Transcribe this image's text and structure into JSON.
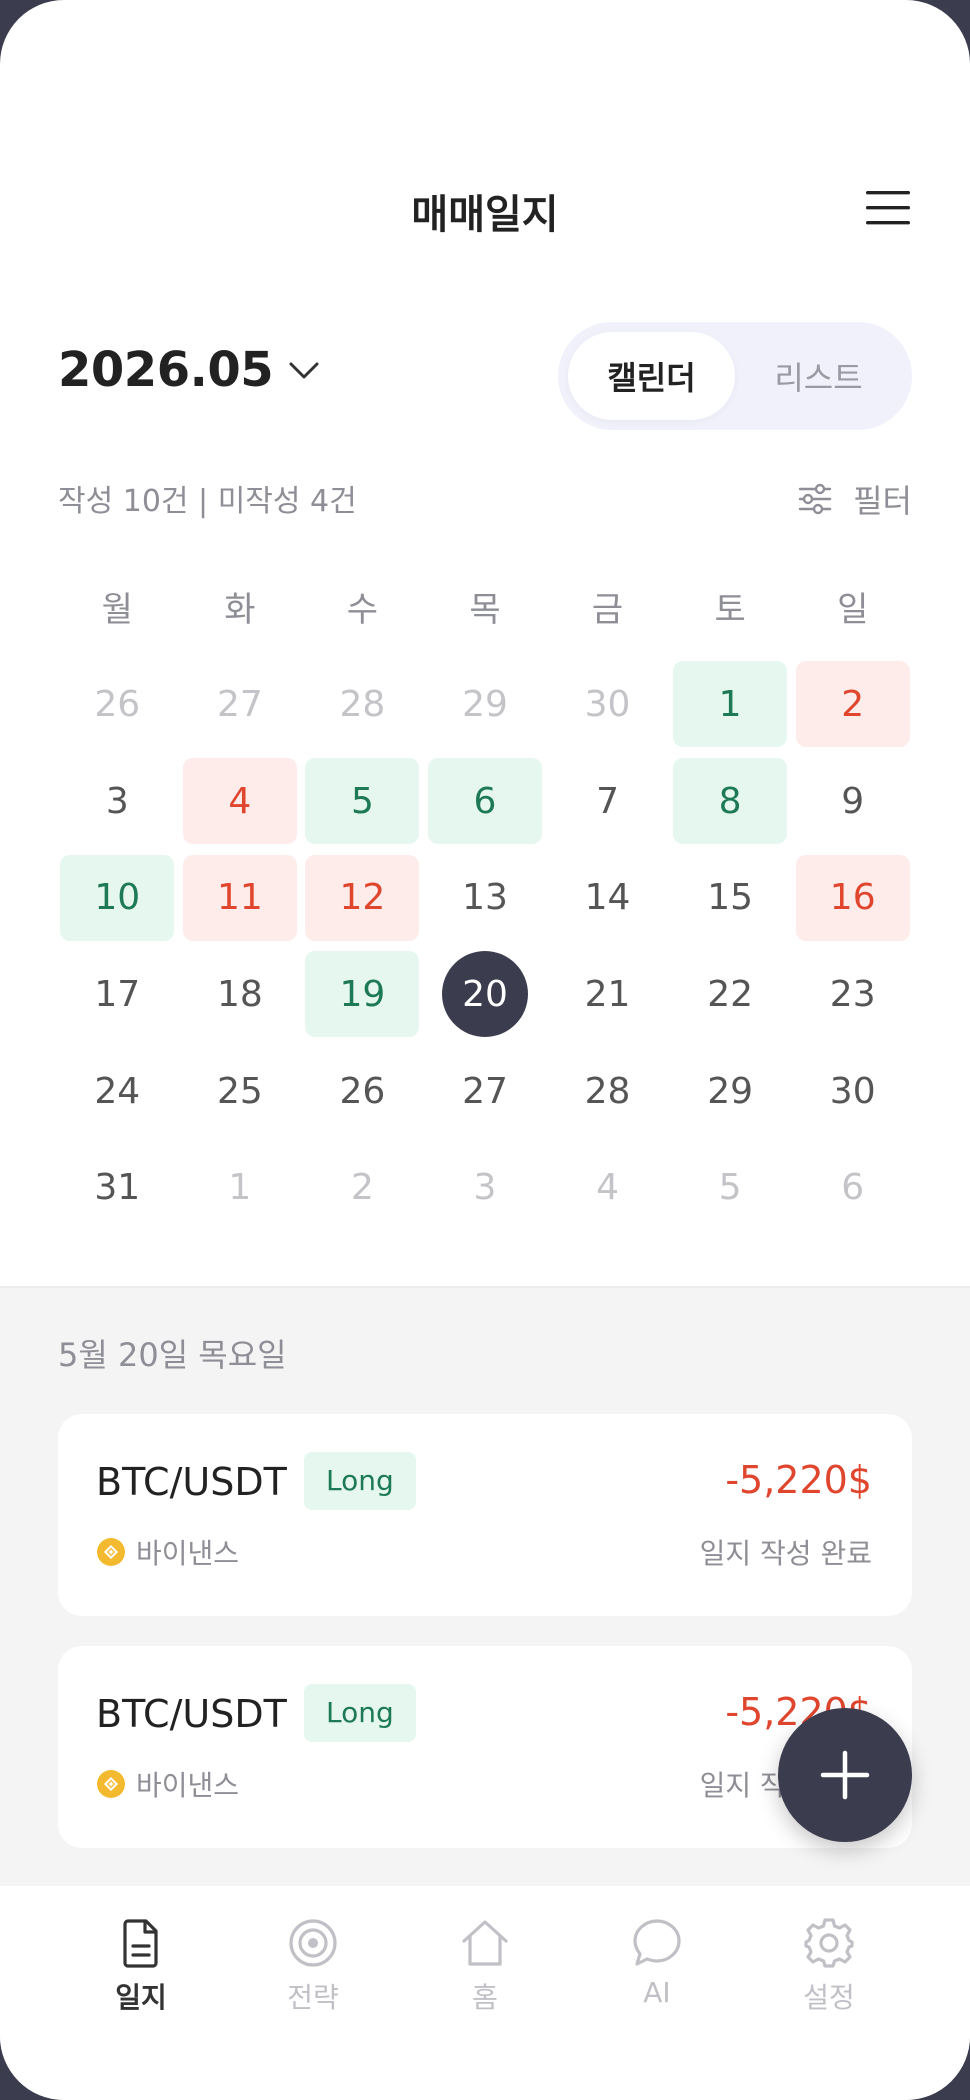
{
  "header": {
    "title": "매매일지"
  },
  "month": {
    "label": "2026.05"
  },
  "view_toggle": {
    "calendar": "캘린더",
    "list": "리스트"
  },
  "summary": {
    "text": "작성 10건 | 미작성 4건",
    "filter_label": "필터"
  },
  "calendar": {
    "weekdays": [
      "월",
      "화",
      "수",
      "목",
      "금",
      "토",
      "일"
    ],
    "days": [
      {
        "n": "26",
        "s": "other"
      },
      {
        "n": "27",
        "s": "other"
      },
      {
        "n": "28",
        "s": "other"
      },
      {
        "n": "29",
        "s": "other"
      },
      {
        "n": "30",
        "s": "other"
      },
      {
        "n": "1",
        "s": "profit"
      },
      {
        "n": "2",
        "s": "loss"
      },
      {
        "n": "3",
        "s": "plain"
      },
      {
        "n": "4",
        "s": "loss"
      },
      {
        "n": "5",
        "s": "profit"
      },
      {
        "n": "6",
        "s": "profit"
      },
      {
        "n": "7",
        "s": "plain"
      },
      {
        "n": "8",
        "s": "profit"
      },
      {
        "n": "9",
        "s": "plain"
      },
      {
        "n": "10",
        "s": "profit"
      },
      {
        "n": "11",
        "s": "loss"
      },
      {
        "n": "12",
        "s": "loss"
      },
      {
        "n": "13",
        "s": "plain"
      },
      {
        "n": "14",
        "s": "plain"
      },
      {
        "n": "15",
        "s": "plain"
      },
      {
        "n": "16",
        "s": "loss"
      },
      {
        "n": "17",
        "s": "plain"
      },
      {
        "n": "18",
        "s": "plain"
      },
      {
        "n": "19",
        "s": "profit"
      },
      {
        "n": "20",
        "s": "selected"
      },
      {
        "n": "21",
        "s": "plain"
      },
      {
        "n": "22",
        "s": "plain"
      },
      {
        "n": "23",
        "s": "plain"
      },
      {
        "n": "24",
        "s": "plain"
      },
      {
        "n": "25",
        "s": "plain"
      },
      {
        "n": "26",
        "s": "plain"
      },
      {
        "n": "27",
        "s": "plain"
      },
      {
        "n": "28",
        "s": "plain"
      },
      {
        "n": "29",
        "s": "plain"
      },
      {
        "n": "30",
        "s": "plain"
      },
      {
        "n": "31",
        "s": "plain"
      },
      {
        "n": "1",
        "s": "other"
      },
      {
        "n": "2",
        "s": "other"
      },
      {
        "n": "3",
        "s": "other"
      },
      {
        "n": "4",
        "s": "other"
      },
      {
        "n": "5",
        "s": "other"
      },
      {
        "n": "6",
        "s": "other"
      }
    ]
  },
  "selected_date": {
    "label": "5월 20일 목요일"
  },
  "trades": [
    {
      "pair": "BTC/USDT",
      "side": "Long",
      "exchange": "바이낸스",
      "pnl": "-5,220$",
      "status": "일지 작성 완료"
    },
    {
      "pair": "BTC/USDT",
      "side": "Long",
      "exchange": "바이낸스",
      "pnl": "-5,220$",
      "status": "일지 작성 완료"
    }
  ],
  "bottom_nav": [
    {
      "label": "일지",
      "icon": "document-icon",
      "active": true
    },
    {
      "label": "전략",
      "icon": "target-icon",
      "active": false
    },
    {
      "label": "홈",
      "icon": "home-icon",
      "active": false
    },
    {
      "label": "AI",
      "icon": "chat-bubble-icon",
      "active": false
    },
    {
      "label": "설정",
      "icon": "gear-icon",
      "active": false
    }
  ],
  "colors": {
    "primary": "#3b3d4f",
    "profit_bg": "#e5f7ef",
    "profit_text": "#1e7a56",
    "loss_bg": "#fdecea",
    "loss_text": "#e0452e",
    "binance_yellow": "#f3ba2f"
  }
}
